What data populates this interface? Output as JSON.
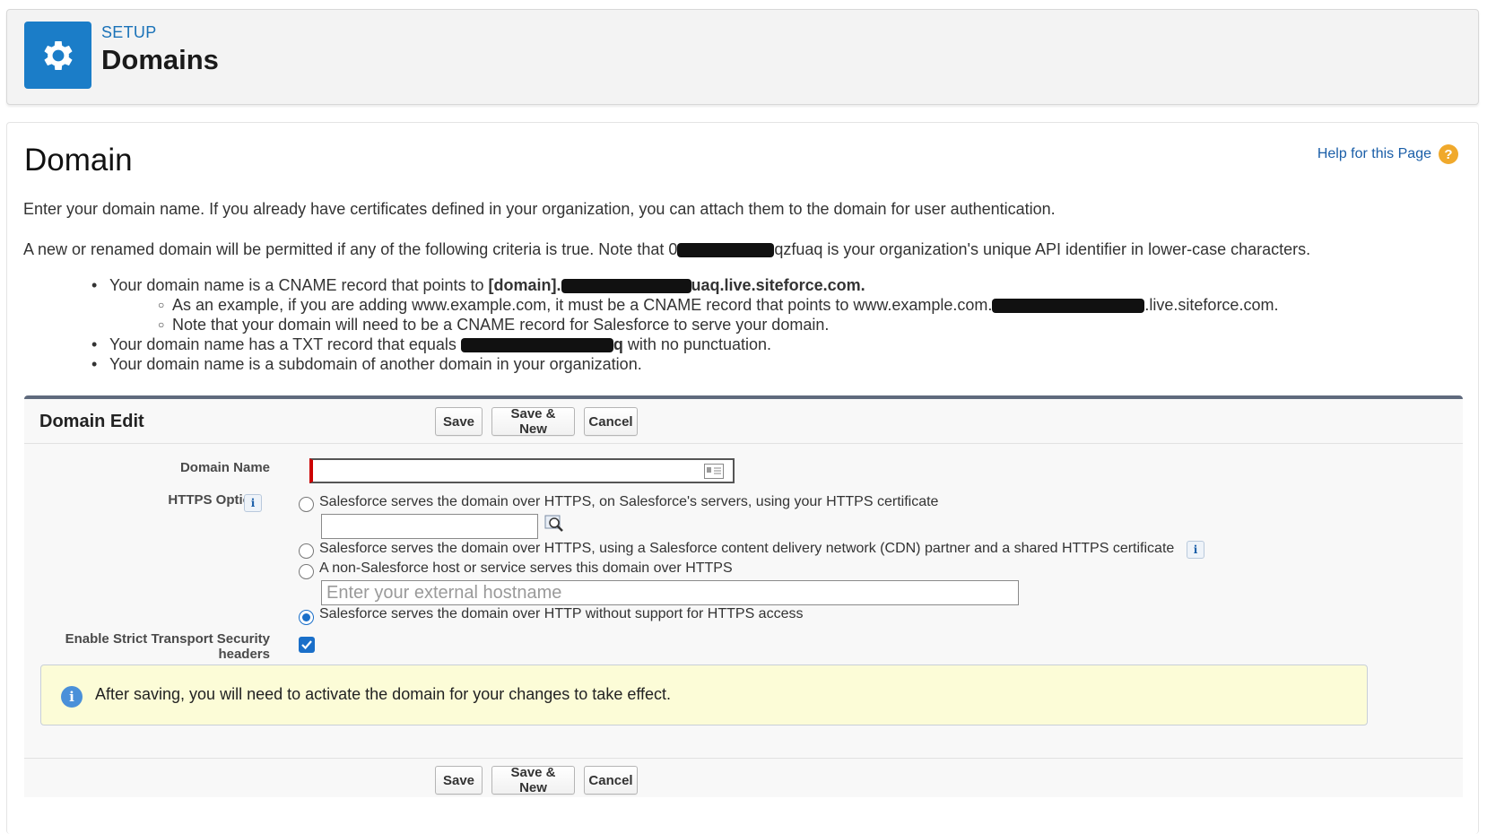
{
  "header": {
    "section_label": "SETUP",
    "title": "Domains",
    "icon": "gear-icon",
    "accent_color": "#1b7dc8"
  },
  "page": {
    "title": "Domain",
    "help_link": "Help for this Page",
    "help_icon": "question-icon",
    "intro": "Enter your domain name. If you already have certificates defined in your organization, you can attach them to the domain for user authentication.",
    "criteria_prefix": "A new or renamed domain will be permitted if any of the following criteria is true. Note that 0",
    "criteria_suffix": "qzfuaq is your organization's unique API identifier in lower-case characters."
  },
  "bullets": {
    "b1_prefix": "Your domain name is a CNAME record that points to ",
    "b1_bold_prefix": "[domain].",
    "b1_bold_suffix": "uaq.live.siteforce.com.",
    "b1_sub1_prefix": "As an example, if you are adding www.example.com, it must be a CNAME record that points to www.example.com.",
    "b1_sub1_suffix": ".live.siteforce.com.",
    "b1_sub2": "Note that your domain will need to be a CNAME record for Salesforce to serve your domain.",
    "b2_prefix": "Your domain name has a TXT record that equals ",
    "b2_bold_suffix": "q",
    "b2_suffix": " with no punctuation.",
    "b3": "Your domain name is a subdomain of another domain in your organization."
  },
  "edit": {
    "title": "Domain Edit",
    "buttons": {
      "save": "Save",
      "save_new": "Save & New",
      "cancel": "Cancel"
    },
    "domain_name_label": "Domain Name",
    "domain_name_value": "",
    "https_label": "HTTPS Option",
    "https_options": [
      {
        "label": "Salesforce serves the domain over HTTPS, on Salesforce's servers, using your HTTPS certificate",
        "checked": false
      },
      {
        "label": "Salesforce serves the domain over HTTPS, using a Salesforce content delivery network (CDN) partner and a shared HTTPS certificate",
        "checked": false
      },
      {
        "label": "A non-Salesforce host or service serves this domain over HTTPS",
        "checked": false
      },
      {
        "label": "Salesforce serves the domain over HTTP without support for HTTPS access",
        "checked": true
      }
    ],
    "external_hostname_placeholder": "Enter your external hostname",
    "hsts_label_line1": "Enable Strict Transport Security",
    "hsts_label_line2": "headers",
    "hsts_checked": true,
    "notice": "After saving, you will need to activate the domain for your changes to take effect."
  }
}
